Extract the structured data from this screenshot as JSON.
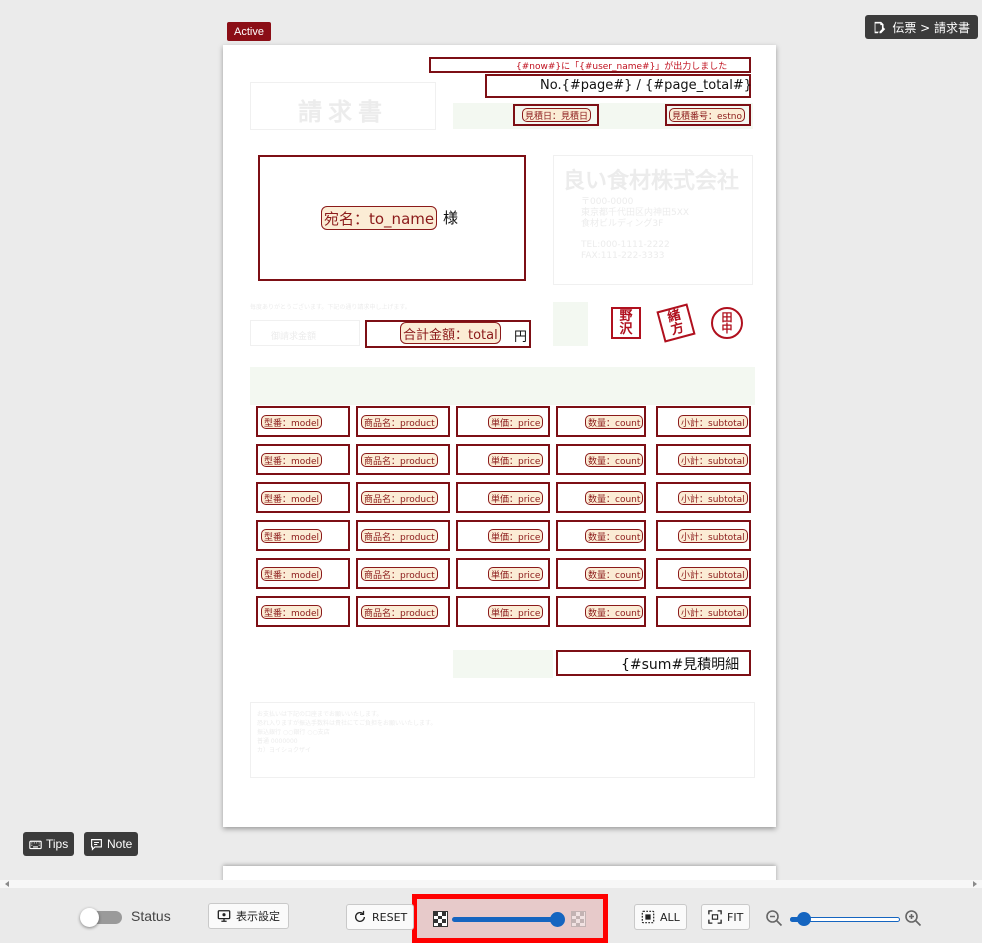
{
  "canvas": {
    "active_badge": "Active",
    "breadcrumb": "伝票 > 請求書"
  },
  "document": {
    "background_title": "請求書",
    "background_company": "良い食材株式会社",
    "background_address_lines": [
      "〒000-0000",
      "東京都千代田区内神田5XX",
      "食材ビルディング3F",
      "TEL:000-1111-2222",
      "FAX:111-222-3333"
    ],
    "background_note": "毎度ありがとうございます。下記の通り請求申し上げます。",
    "background_amount_label": "御請求金額",
    "background_footer_lines": [
      "お支払いは下記の口座までお願いいたします。",
      "恐れ入りますが振込手数料は貴社にてご負担をお願いいたします。",
      "",
      "振込銀行 ○○銀行 ○○支店",
      "普通 0000000",
      "カ）ヨイショクザイ"
    ],
    "header_output_line": "{#now#}に「{#user_name#}」が出力しました",
    "page_number": "No.{#page#} / {#page_total#}",
    "date_tag": "見積日：見積日",
    "estno_tag": "見積番号：estno",
    "recipient_tag": "宛名：to_name",
    "recipient_suffix": "様",
    "total_tag": "合計金額：total",
    "total_suffix": "円",
    "sum_field": "{#sum#見積明細",
    "stamps": [
      {
        "line1": "野",
        "line2": "沢"
      },
      {
        "line1": "緒",
        "line2": "方"
      },
      {
        "line1": "田",
        "line2": "中"
      }
    ],
    "table_row_tags": [
      "型番：model",
      "商品名：product",
      "単価：price",
      "数量：count",
      "小計：subtotal"
    ],
    "table_rows": 6
  },
  "floating": {
    "tips": "Tips",
    "note": "Note"
  },
  "toolbar": {
    "status_label": "Status",
    "status_on": false,
    "display_settings": "表示設定",
    "reset": "RESET",
    "opacity_value": 0.9,
    "all": "ALL",
    "fit": "FIT",
    "zoom_value": 0.1,
    "highlight_color": "#ff0000",
    "accent_color": "#1565c0",
    "brand_dark_red": "#8b0e16"
  },
  "icons": [
    "edit-document-icon",
    "keyboard-icon",
    "comment-icon",
    "monitor-icon",
    "refresh-icon",
    "checker-icon",
    "select-all-icon",
    "fit-screen-icon",
    "zoom-out-icon",
    "zoom-in-icon"
  ]
}
